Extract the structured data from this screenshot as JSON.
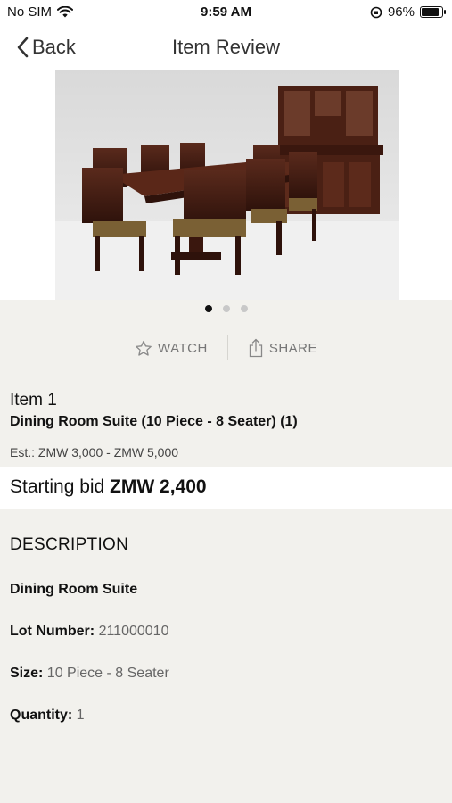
{
  "status": {
    "carrier": "No SIM",
    "time": "9:59 AM",
    "battery": "96%"
  },
  "nav": {
    "back_label": "Back",
    "title": "Item Review"
  },
  "gallery": {
    "pages": 3,
    "active": 0
  },
  "actions": {
    "watch": "WATCH",
    "share": "SHARE"
  },
  "item": {
    "number": "Item 1",
    "title": "Dining Room Suite (10 Piece - 8 Seater) (1)",
    "estimate": "Est.: ZMW 3,000 - ZMW 5,000"
  },
  "bid": {
    "label": "Starting bid",
    "amount": "ZMW 2,400"
  },
  "description": {
    "heading": "DESCRIPTION",
    "name": "Dining Room Suite",
    "lot_label": "Lot Number:",
    "lot_value": "211000010",
    "size_label": "Size:",
    "size_value": "10 Piece - 8 Seater",
    "qty_label": "Quantity:",
    "qty_value": "1"
  }
}
